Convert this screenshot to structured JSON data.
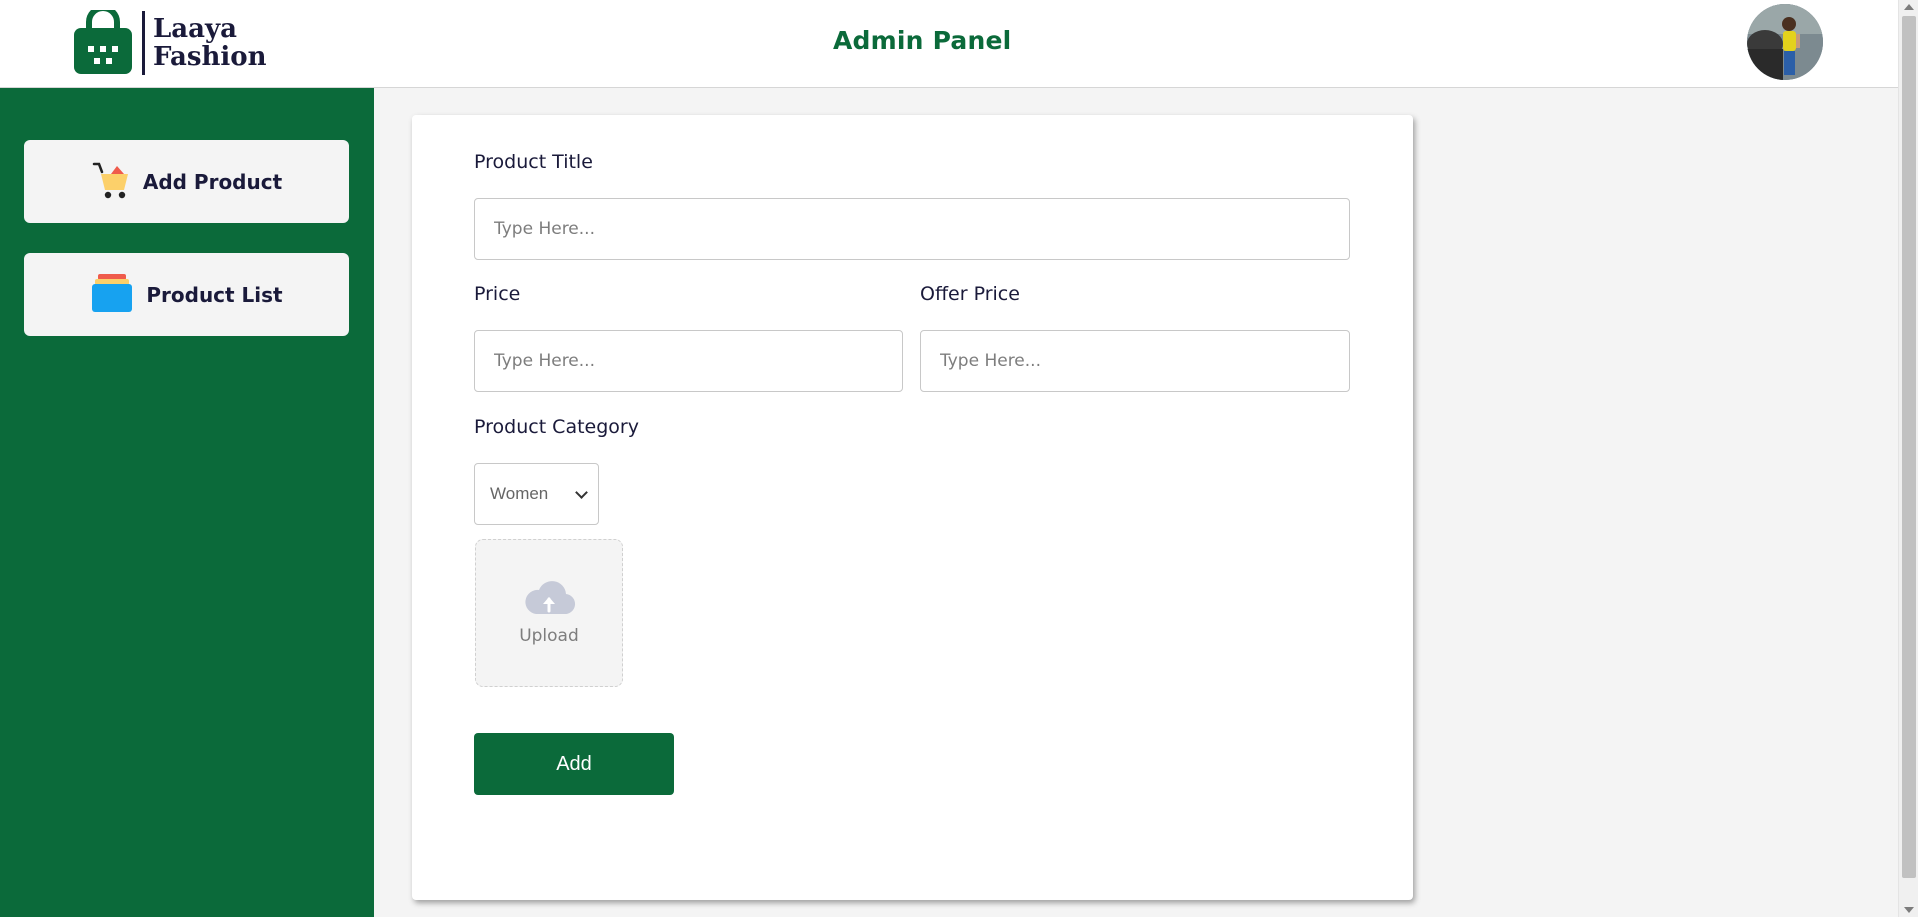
{
  "header": {
    "logo_line1": "Laaya",
    "logo_line2": "Fashion",
    "title": "Admin Panel"
  },
  "sidebar": {
    "items": [
      {
        "label": "Add Product",
        "icon": "cart-icon"
      },
      {
        "label": "Product List",
        "icon": "list-stack-icon"
      }
    ]
  },
  "form": {
    "title_label": "Product Title",
    "title_placeholder": "Type Here...",
    "price_label": "Price",
    "price_placeholder": "Type Here...",
    "offer_label": "Offer Price",
    "offer_placeholder": "Type Here...",
    "category_label": "Product Category",
    "category_value": "Women",
    "upload_label": "Upload",
    "add_label": "Add"
  },
  "colors": {
    "brand_green": "#0b6a3a",
    "page_bg": "#f4f4f4",
    "text_dark": "#1a1a3a"
  }
}
